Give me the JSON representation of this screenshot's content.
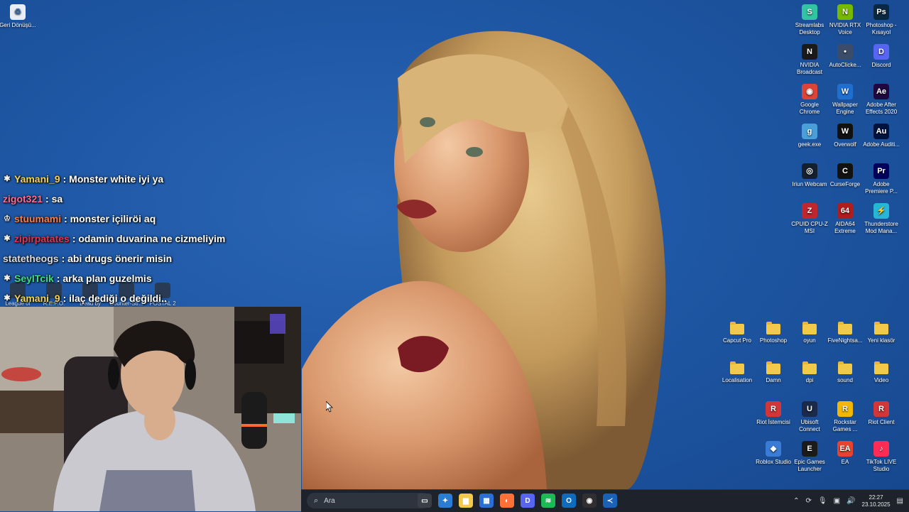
{
  "desktop_icons_left": [
    {
      "id": "recycle",
      "label": "Geri Dönüşü...",
      "icon": "recycle-bin-icon"
    }
  ],
  "desktop_icons_right": [
    {
      "label": "Streamlabs Desktop",
      "icon": "streamlabs-icon",
      "color": "#31c3a2",
      "glyph": "S"
    },
    {
      "label": "NVIDIA RTX Voice",
      "icon": "nvidia-icon",
      "color": "#76b900",
      "glyph": "N"
    },
    {
      "label": "Photoshop - Kısayol",
      "icon": "photoshop-icon",
      "color": "#0b2842",
      "glyph": "Ps"
    },
    {
      "label": "NVIDIA Broadcast",
      "icon": "nvidia-broadcast-icon",
      "color": "#1a1a1a",
      "glyph": "N"
    },
    {
      "label": "AutoClicke...",
      "icon": "mouse-icon",
      "color": "#3a4c6a",
      "glyph": "•"
    },
    {
      "label": "Discord",
      "icon": "discord-icon",
      "color": "#5865f2",
      "glyph": "D"
    },
    {
      "label": "Google Chrome",
      "icon": "chrome-icon",
      "color": "#db4437",
      "glyph": "◉"
    },
    {
      "label": "Wallpaper Engine",
      "icon": "wallpaper-engine-icon",
      "color": "#1f6fd1",
      "glyph": "W"
    },
    {
      "label": "Adobe After Effects 2020",
      "icon": "after-effects-icon",
      "color": "#1f0740",
      "glyph": "Ae"
    },
    {
      "label": "geek.exe",
      "icon": "geek-icon",
      "color": "#4a9fd8",
      "glyph": "g"
    },
    {
      "label": "Overwolf",
      "icon": "overwolf-icon",
      "color": "#111111",
      "glyph": "W"
    },
    {
      "label": "Adobe Auditi...",
      "icon": "audition-icon",
      "color": "#00133d",
      "glyph": "Au"
    },
    {
      "label": "Iriun Webcam",
      "icon": "webcam-icon",
      "color": "#14202e",
      "glyph": "◎"
    },
    {
      "label": "CurseForge",
      "icon": "curseforge-icon",
      "color": "#121212",
      "glyph": "C"
    },
    {
      "label": "Adobe Premiere P...",
      "icon": "premiere-icon",
      "color": "#00005b",
      "glyph": "Pr"
    },
    {
      "label": "CPUID CPU-Z MSI",
      "icon": "cpuz-icon",
      "color": "#c0262d",
      "glyph": "Z"
    },
    {
      "label": "AIDA64 Extreme",
      "icon": "aida64-icon",
      "color": "#b11c1c",
      "glyph": "64"
    },
    {
      "label": "Thunderstore Mod Mana...",
      "icon": "thunderstore-icon",
      "color": "#27b6d6",
      "glyph": "⚡"
    }
  ],
  "desktop_folders": [
    {
      "label": "Capcut Pro",
      "icon": "folder-icon"
    },
    {
      "label": "Photoshop",
      "icon": "folder-icon"
    },
    {
      "label": "oyun",
      "icon": "folder-icon"
    },
    {
      "label": "FiveNightsa...",
      "icon": "folder-icon"
    },
    {
      "label": "Yeni klasör",
      "icon": "folder-icon"
    },
    {
      "label": "Localisation",
      "icon": "folder-icon"
    },
    {
      "label": "Damn",
      "icon": "folder-icon"
    },
    {
      "label": "dpi",
      "icon": "folder-icon"
    },
    {
      "label": "sound",
      "icon": "folder-icon"
    },
    {
      "label": "Video",
      "icon": "folder-icon"
    }
  ],
  "desktop_apps_bottom": [
    {
      "label": "Riot İstemcisi",
      "icon": "riot-icon",
      "color": "#d13639",
      "glyph": "R"
    },
    {
      "label": "Ubisoft Connect",
      "icon": "ubisoft-icon",
      "color": "#1b2a4a",
      "glyph": "U"
    },
    {
      "label": "Rockstar Games ...",
      "icon": "rockstar-icon",
      "color": "#f2b705",
      "glyph": "R"
    },
    {
      "label": "Riot Client",
      "icon": "riot-client-icon",
      "color": "#d13639",
      "glyph": "R"
    },
    {
      "label": "Roblox Studio",
      "icon": "roblox-icon",
      "color": "#3a7bd5",
      "glyph": "◆"
    },
    {
      "label": "Epic Games Launcher",
      "icon": "epic-icon",
      "color": "#1b1b1b",
      "glyph": "E"
    },
    {
      "label": "EA",
      "icon": "ea-icon",
      "color": "#e8432f",
      "glyph": "EA"
    },
    {
      "label": "TikTok LIVE Studio",
      "icon": "tiktok-icon",
      "color": "#fe2c55",
      "glyph": "♪"
    }
  ],
  "hidden_icons_row": [
    {
      "label": "League of"
    },
    {
      "label": "R.E.P.O."
    },
    {
      "label": "Dead by"
    },
    {
      "label": "Counter-Str..."
    },
    {
      "label": "POSTAL 2"
    }
  ],
  "chat": [
    {
      "badge": "star",
      "user": "Yamani_9",
      "color": "#f4d35e",
      "msg": ": Monster white iyi ya"
    },
    {
      "badge": "",
      "user": "zigot321",
      "color": "#ff6b8a",
      "msg": ": sa"
    },
    {
      "badge": "crown",
      "user": "stuumami",
      "color": "#ff7a3d",
      "msg": ": monster içiliröi aq"
    },
    {
      "badge": "star",
      "user": "zipirpatates",
      "color": "#e8324a",
      "msg": ": odamin duvarina ne cizmeliyim"
    },
    {
      "badge": "",
      "user": "statetheogs",
      "color": "#dcdcdc",
      "msg": ": abi drugs önerir misin"
    },
    {
      "badge": "star",
      "user": "SeyITcik",
      "color": "#3ddc84",
      "msg": ": arka plan guzelmis"
    },
    {
      "badge": "star",
      "user": "Yamani_9",
      "color": "#f4d35e",
      "msg": ": ilaç dediği o değildi.."
    }
  ],
  "taskbar": {
    "search_placeholder": "Ara",
    "apps": [
      {
        "name": "task-view",
        "color": "#3a3f47",
        "glyph": "▭"
      },
      {
        "name": "copilot",
        "color": "#2b7cd3",
        "glyph": "✦"
      },
      {
        "name": "file-explorer",
        "color": "#f3c94a",
        "glyph": "▆"
      },
      {
        "name": "store",
        "color": "#2a6fd6",
        "glyph": "▦"
      },
      {
        "name": "firefox",
        "color": "#ff7139",
        "glyph": "◐"
      },
      {
        "name": "discord",
        "color": "#5865f2",
        "glyph": "D"
      },
      {
        "name": "spotify",
        "color": "#1db954",
        "glyph": "≋"
      },
      {
        "name": "outlook",
        "color": "#0f6cbd",
        "glyph": "O"
      },
      {
        "name": "obs",
        "color": "#302e31",
        "glyph": "◉"
      },
      {
        "name": "vscode-like",
        "color": "#1a62b8",
        "glyph": "≺"
      }
    ],
    "time": "22:27",
    "date": "23.10.2025"
  }
}
